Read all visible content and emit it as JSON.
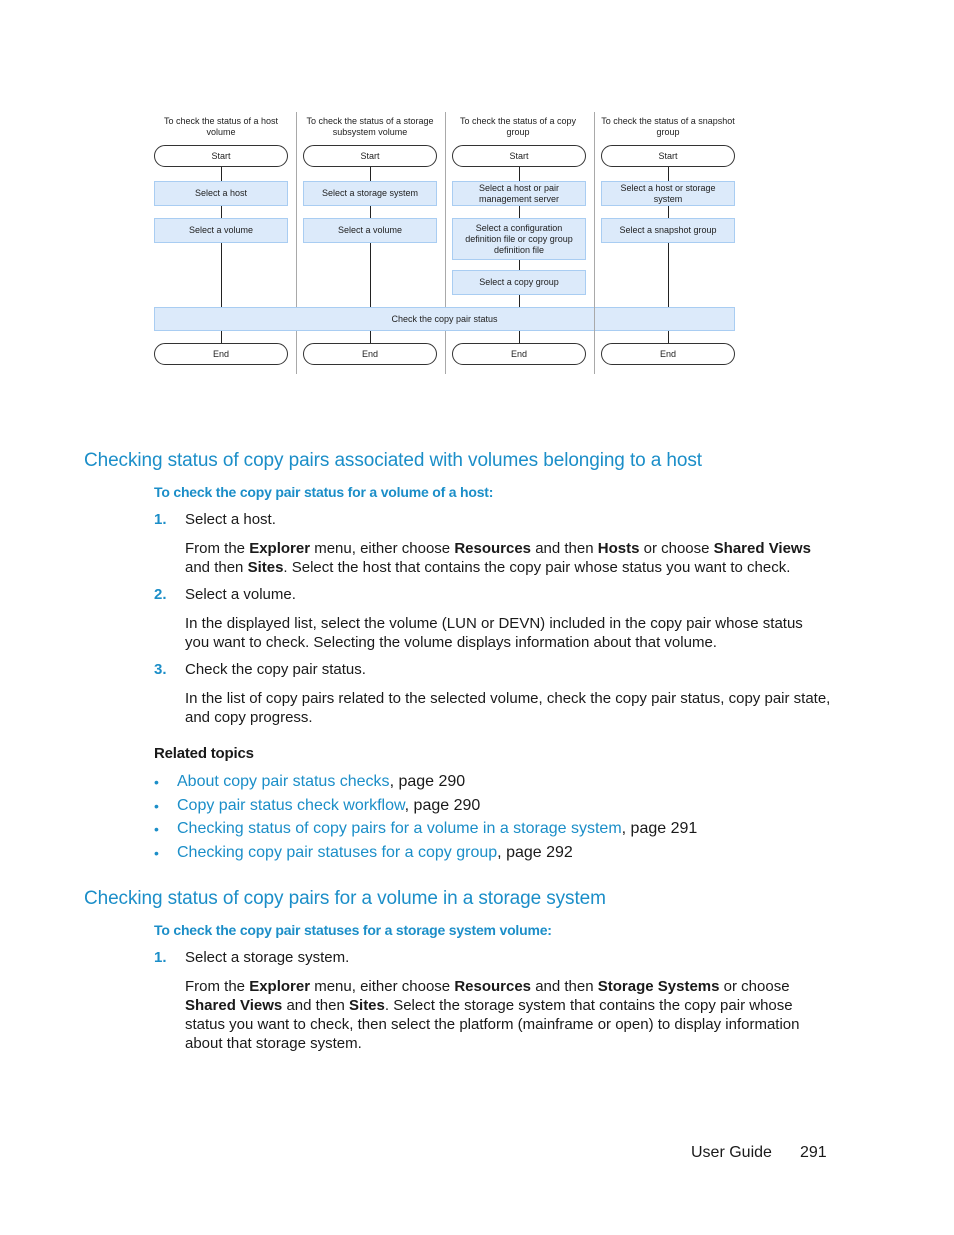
{
  "diagram": {
    "lanes": [
      {
        "title": "To check the status of a host volume",
        "start": "Start",
        "steps": [
          "Select a host",
          "Select a volume"
        ],
        "end": "End"
      },
      {
        "title": "To check the status of a storage subsystem volume",
        "start": "Start",
        "steps": [
          "Select a storage system",
          "Select a volume"
        ],
        "end": "End"
      },
      {
        "title": "To check the status of a copy group",
        "start": "Start",
        "steps": [
          "Select a host or pair management server",
          "Select a configuration definition file or copy group definition file",
          "Select a copy group"
        ],
        "end": "End"
      },
      {
        "title": "To check the status of a snapshot group",
        "start": "Start",
        "steps": [
          "Select a host or storage system",
          "Select a snapshot group"
        ],
        "end": "End"
      }
    ],
    "shared_step": "Check the copy pair status"
  },
  "section1": {
    "heading": "Checking status of copy pairs associated with volumes belonging to a host",
    "procedure_title": "To check the copy pair status for a volume of a host:",
    "steps": [
      {
        "num": "1.",
        "text": "Select a host.",
        "detail": [
          {
            "t": "From the "
          },
          {
            "b": "Explorer"
          },
          {
            "t": " menu, either choose "
          },
          {
            "b": "Resources"
          },
          {
            "t": " and then "
          },
          {
            "b": "Hosts"
          },
          {
            "t": " or choose "
          },
          {
            "b": "Shared Views"
          },
          {
            "t": " and then "
          },
          {
            "b": "Sites"
          },
          {
            "t": ". Select the host that contains the copy pair whose status you want to check."
          }
        ]
      },
      {
        "num": "2.",
        "text": "Select a volume.",
        "detail": [
          {
            "t": "In the displayed list, select the volume (LUN or DEVN) included in the copy pair whose status you want to check. Selecting the volume displays information about that volume."
          }
        ]
      },
      {
        "num": "3.",
        "text": "Check the copy pair status.",
        "detail": [
          {
            "t": "In the list of copy pairs related to the selected volume, check the copy pair status, copy pair state, and copy progress."
          }
        ]
      }
    ],
    "related_heading": "Related topics",
    "related": [
      {
        "link": "About copy pair status checks",
        "page": ", page 290"
      },
      {
        "link": "Copy pair status check workflow",
        "page": ", page 290"
      },
      {
        "link": "Checking status of copy pairs for a volume in a storage system",
        "page": ", page 291"
      },
      {
        "link": "Checking copy pair statuses for a copy group",
        "page": ", page 292"
      }
    ]
  },
  "section2": {
    "heading": "Checking status of copy pairs for a volume in a storage system",
    "procedure_title": "To check the copy pair statuses for a storage system volume:",
    "steps": [
      {
        "num": "1.",
        "text": "Select a storage system.",
        "detail": [
          {
            "t": "From the "
          },
          {
            "b": "Explorer"
          },
          {
            "t": " menu, either choose "
          },
          {
            "b": "Resources"
          },
          {
            "t": " and then "
          },
          {
            "b": "Storage Systems"
          },
          {
            "t": " or choose "
          },
          {
            "b": "Shared Views"
          },
          {
            "t": " and then "
          },
          {
            "b": "Sites"
          },
          {
            "t": ". Select the storage system that contains the copy pair whose status you want to check, then select the platform (mainframe or open) to display information about that storage system."
          }
        ]
      }
    ]
  },
  "footer": {
    "guide_label": "User Guide",
    "page_number": "291"
  },
  "colors": {
    "accent": "#1b8ec8",
    "process_fill": "#dceafa",
    "process_border": "#a9cdf2"
  }
}
